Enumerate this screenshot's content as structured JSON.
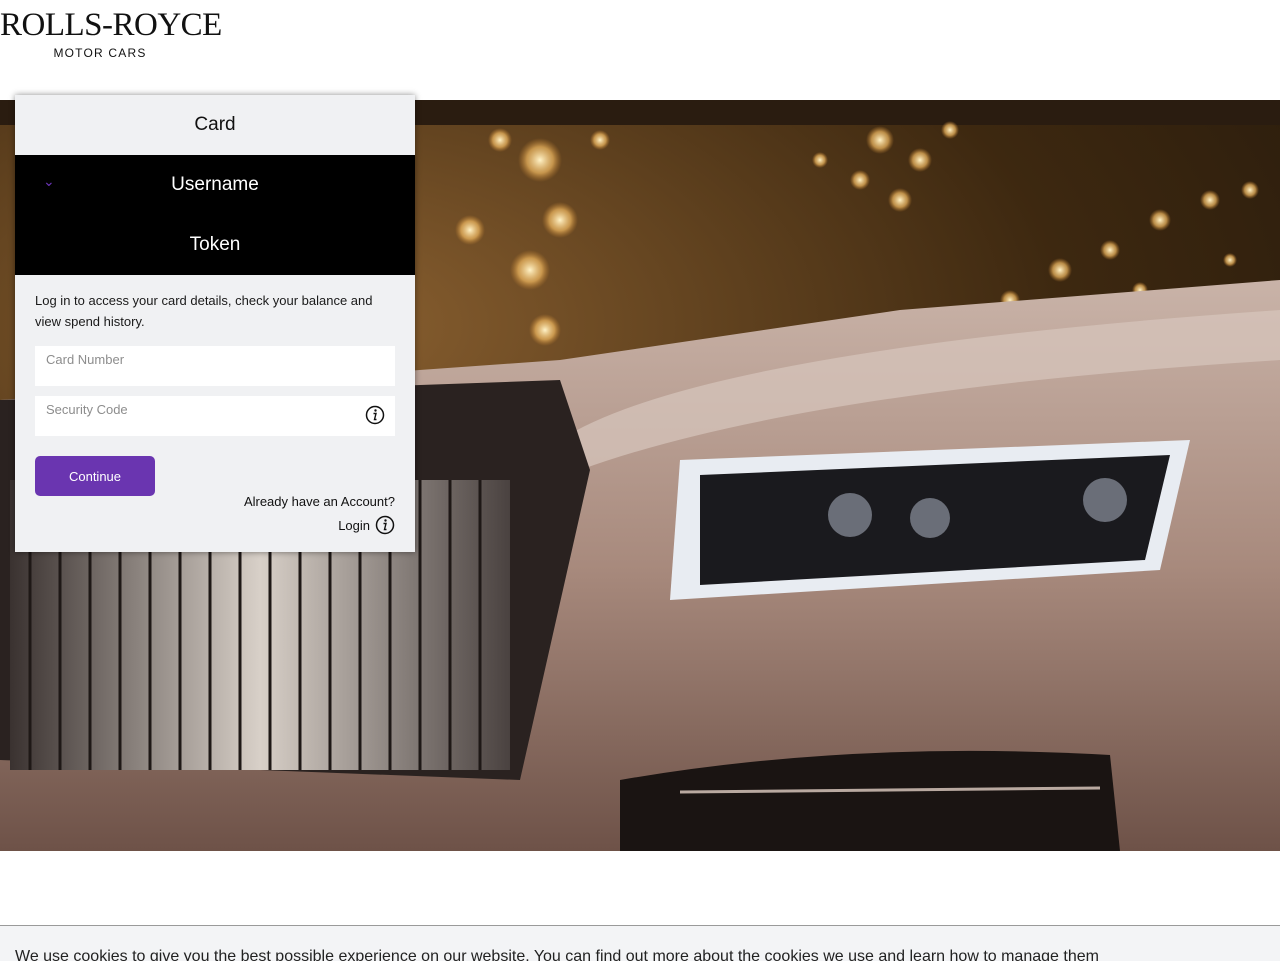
{
  "brand": {
    "name": "ROLLS-ROYCE",
    "subtitle": "MOTOR CARS"
  },
  "tabs": [
    {
      "label": "Card",
      "active": true
    },
    {
      "label": "Username",
      "active": false
    },
    {
      "label": "Token",
      "active": false
    }
  ],
  "form": {
    "intro": "Log in to access your card details, check your balance and view spend history.",
    "card_number_placeholder": "Card Number",
    "card_number_value": "",
    "security_code_placeholder": "Security Code",
    "security_code_value": "",
    "continue_label": "Continue",
    "already_account": "Already have an Account?",
    "login_label": "Login"
  },
  "cookie": {
    "text": "We use cookies to give you the best possible experience on our website. You can find out more about the cookies we use and learn how to manage them"
  },
  "colors": {
    "accent": "#6a35b0",
    "tab_dark": "#000000",
    "panel_bg": "#f0f1f3"
  },
  "icons": {
    "tab_chevron": "chevron-down-icon",
    "security_info": "info-icon",
    "login_info": "info-icon"
  }
}
